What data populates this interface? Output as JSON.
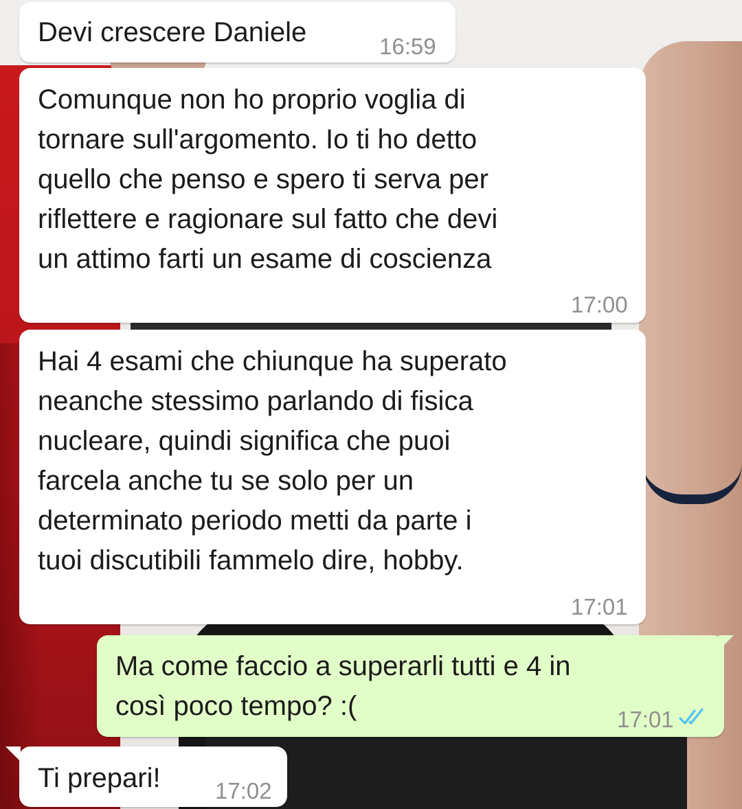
{
  "messages": [
    {
      "direction": "incoming",
      "text": "Devi crescere Daniele",
      "time": "16:59"
    },
    {
      "direction": "incoming",
      "text": "Comunque non ho proprio voglia di\ntornare sull'argomento. Io ti ho detto\nquello che penso e spero ti serva per\nriflettere e ragionare sul fatto che devi\nun attimo farti un esame di coscienza",
      "time": "17:00"
    },
    {
      "direction": "incoming",
      "text": "Hai 4 esami che chiunque ha superato\nneanche stessimo parlando di fisica\nnucleare, quindi significa che puoi\nfarcela anche tu se solo per un\ndeterminato periodo metti da parte i\ntuoi discutibili fammelo dire, hobby.",
      "time": "17:01"
    },
    {
      "direction": "outgoing",
      "text": "Ma come faccio a superarli tutti e 4 in\ncosì poco tempo? :(",
      "time": "17:01",
      "status": "read",
      "status_icon": "double-check-icon",
      "status_color": "#4fc3f7"
    },
    {
      "direction": "incoming",
      "text": "Ti prepari!",
      "time": "17:02"
    }
  ],
  "colors": {
    "incoming_bubble": "#ffffff",
    "outgoing_bubble": "#e2fec8",
    "timestamp": "#8f8f8f",
    "read_ticks": "#4fc3f7"
  }
}
